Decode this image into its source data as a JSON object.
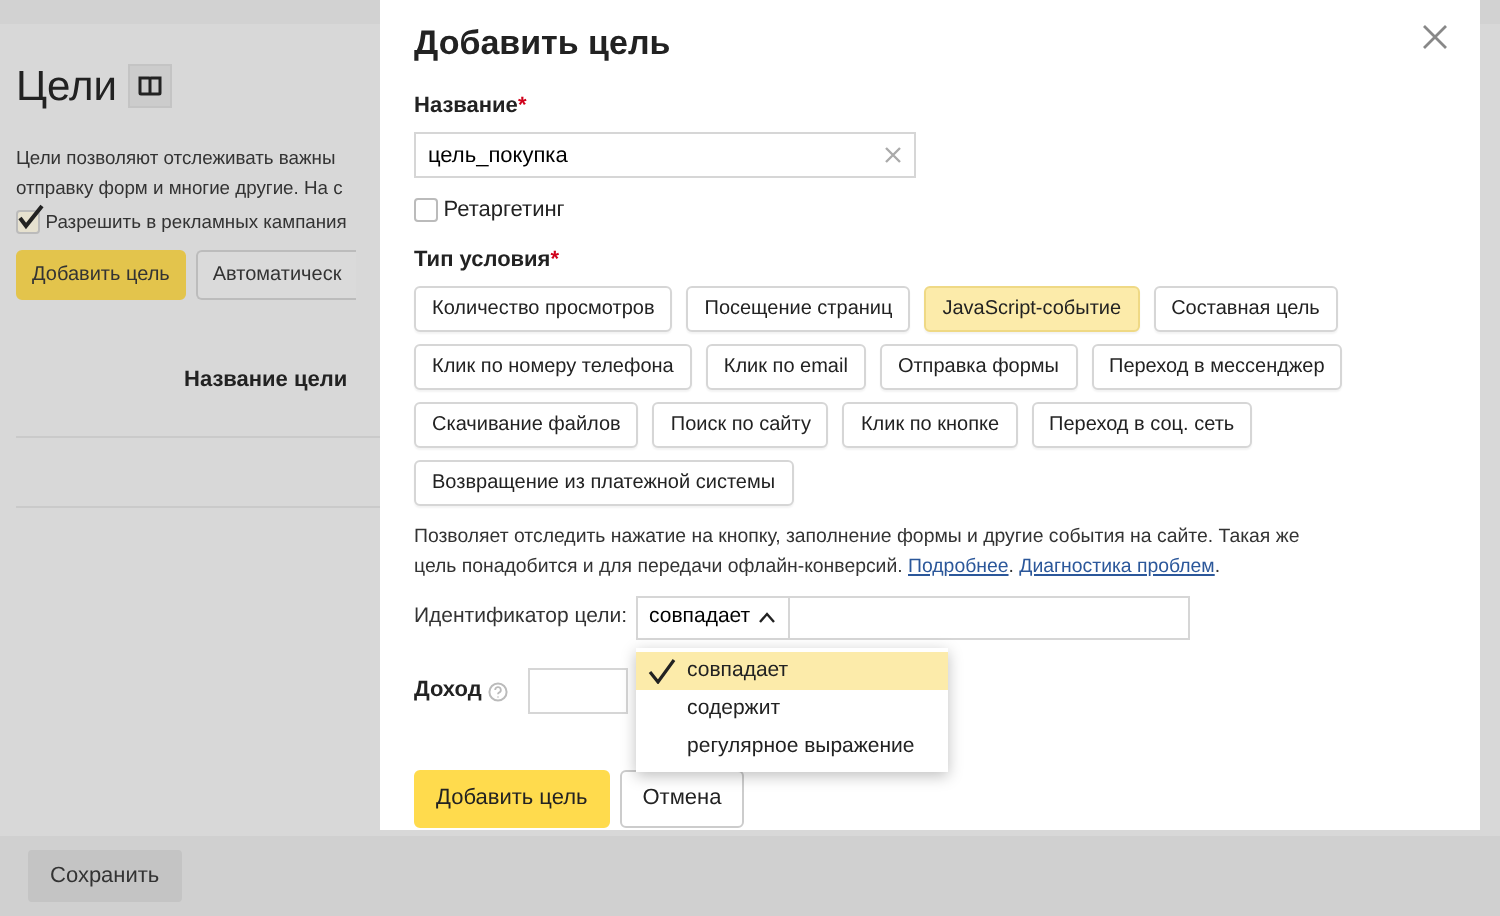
{
  "page": {
    "title": "Цели",
    "description": [
      "Цели позволяют отслеживать важны",
      "отправку форм и многие другие. На с"
    ],
    "campaign_checkbox": {
      "label": "Разрешить в рекламных кампания",
      "checked": true
    },
    "buttons": [
      {
        "label": "Добавить цель",
        "kind": "primary"
      },
      {
        "label": "Автоматическ",
        "kind": "default"
      }
    ],
    "table": {
      "columns": [
        "Название цели"
      ]
    },
    "footer": {
      "save_button": "Сохранить"
    }
  },
  "modal": {
    "title": "Добавить цель",
    "name_field": {
      "label": "Название",
      "required_mark": "*",
      "value": "цель_покупка"
    },
    "retargeting": {
      "label": "Ретаргетинг",
      "checked": false
    },
    "condition_type": {
      "label": "Тип условия",
      "required_mark": "*",
      "options": [
        {
          "label": "Количество просмотров",
          "selected": false
        },
        {
          "label": "Посещение страниц",
          "selected": false
        },
        {
          "label": "JavaScript-событие",
          "selected": true
        },
        {
          "label": "Составная цель",
          "selected": false
        },
        {
          "label": "Клик по номеру телефона",
          "selected": false
        },
        {
          "label": "Клик по email",
          "selected": false
        },
        {
          "label": "Отправка формы",
          "selected": false
        },
        {
          "label": "Переход в мессенджер",
          "selected": false
        },
        {
          "label": "Скачивание файлов",
          "selected": false
        },
        {
          "label": "Поиск по сайту",
          "selected": false
        },
        {
          "label": "Клик по кнопке",
          "selected": false
        },
        {
          "label": "Переход в соц. сеть",
          "selected": false
        },
        {
          "label": "Возвращение из платежной системы",
          "selected": false
        }
      ]
    },
    "hint": [
      {
        "kind": "text",
        "text": "Позволяет отследить нажатие на кнопку, заполнение формы и другие события на сайте. Такая же цель понадобится и для передачи офлайн-конверсий. "
      },
      {
        "kind": "link",
        "text": "Подробнее"
      },
      {
        "kind": "text",
        "text": ". "
      },
      {
        "kind": "link",
        "text": "Диагностика проблем"
      },
      {
        "kind": "text",
        "text": "."
      }
    ],
    "identifier": {
      "label": "Идентификатор цели:",
      "match": "совпадает",
      "expanded": true,
      "options": [
        {
          "label": "совпадает",
          "selected": true
        },
        {
          "label": "содержит",
          "selected": false
        },
        {
          "label": "регулярное выражение",
          "selected": false
        }
      ]
    },
    "income": {
      "label": "Доход"
    },
    "buttons": [
      {
        "label": "Добавить цель",
        "kind": "primary"
      },
      {
        "label": "Отмена",
        "kind": "default"
      }
    ]
  }
}
